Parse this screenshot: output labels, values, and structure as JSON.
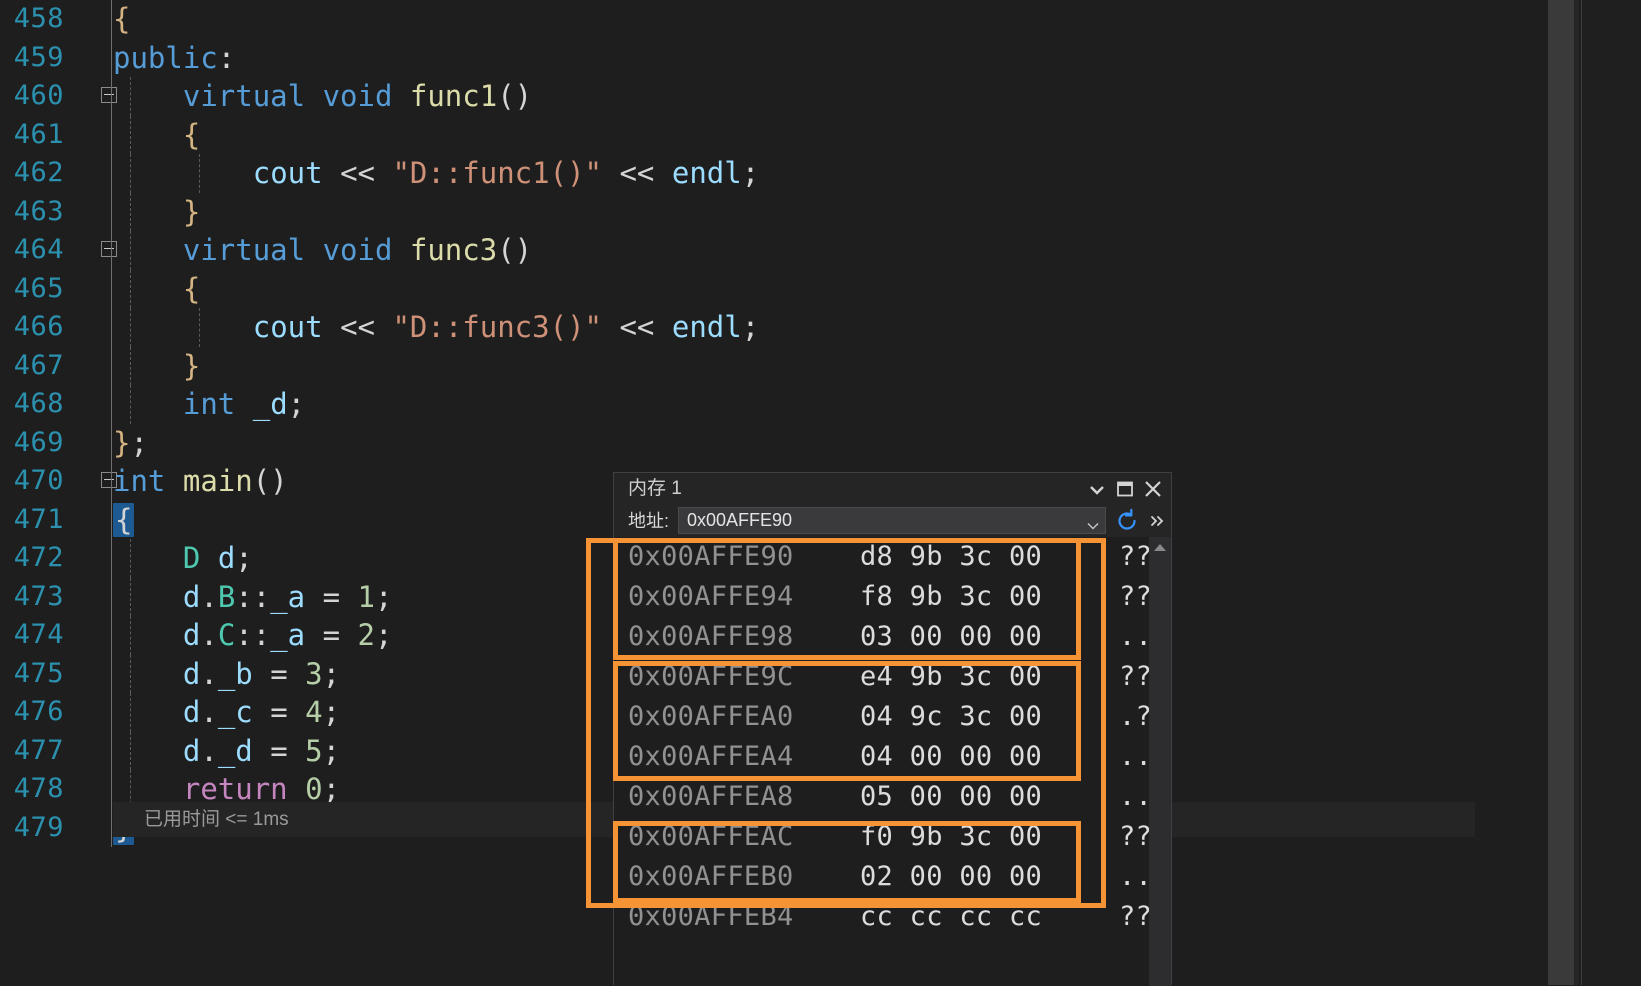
{
  "editor": {
    "lines": [
      {
        "num": "458",
        "fold": false,
        "guides": [],
        "html_id": "l458"
      },
      {
        "num": "459",
        "fold": false,
        "guides": []
      },
      {
        "num": "460",
        "fold": true,
        "guides": [
          "g1"
        ]
      },
      {
        "num": "461",
        "fold": false,
        "guides": [
          "g1"
        ]
      },
      {
        "num": "462",
        "fold": false,
        "guides": [
          "g1",
          "g2"
        ]
      },
      {
        "num": "463",
        "fold": false,
        "guides": [
          "g1"
        ]
      },
      {
        "num": "464",
        "fold": true,
        "guides": [
          "g1"
        ]
      },
      {
        "num": "465",
        "fold": false,
        "guides": [
          "g1"
        ]
      },
      {
        "num": "466",
        "fold": false,
        "guides": [
          "g1",
          "g2"
        ]
      },
      {
        "num": "467",
        "fold": false,
        "guides": [
          "g1"
        ]
      },
      {
        "num": "468",
        "fold": false,
        "guides": [
          "g1"
        ]
      },
      {
        "num": "469",
        "fold": false,
        "guides": []
      },
      {
        "num": "470",
        "fold": true,
        "guides": []
      },
      {
        "num": "471",
        "fold": false,
        "guides": []
      },
      {
        "num": "472",
        "fold": false,
        "guides": [
          "g1"
        ]
      },
      {
        "num": "473",
        "fold": false,
        "guides": [
          "g1"
        ]
      },
      {
        "num": "474",
        "fold": false,
        "guides": [
          "g1"
        ]
      },
      {
        "num": "475",
        "fold": false,
        "guides": [
          "g1"
        ]
      },
      {
        "num": "476",
        "fold": false,
        "guides": [
          "g1"
        ]
      },
      {
        "num": "477",
        "fold": false,
        "guides": [
          "g1"
        ]
      },
      {
        "num": "478",
        "fold": false,
        "guides": [
          "g1"
        ]
      },
      {
        "num": "479",
        "fold": false,
        "guides": []
      }
    ],
    "line_numbers": [
      "458",
      "459",
      "460",
      "461",
      "462",
      "463",
      "464",
      "465",
      "466",
      "467",
      "468",
      "469",
      "470",
      "471",
      "472",
      "473",
      "474",
      "475",
      "476",
      "477",
      "478",
      "479"
    ],
    "code_text": [
      "{",
      "public:",
      "    virtual void func1()",
      "    {",
      "        cout << \"D::func1()\" << endl;",
      "    }",
      "    virtual void func3()",
      "    {",
      "        cout << \"D::func3()\" << endl;",
      "    }",
      "    int _d;",
      "};",
      "int main()",
      "{",
      "    D d;",
      "    d.B::_a = 1;",
      "    d.C::_a = 2;",
      "    d._b = 3;",
      "    d._c = 4;",
      "    d._d = 5;",
      "    return 0;",
      "}"
    ],
    "elapsed_time": "已用时间 <= 1ms",
    "colors": {
      "background": "#1e1e1e",
      "line_number": "#2b91af",
      "keyword": "#569cd6",
      "type": "#4ec9b0",
      "function": "#dcdcaa",
      "string": "#ce9178",
      "variable": "#9cdcfe",
      "number": "#b5cea8",
      "control": "#c586c0",
      "brace_highlight": "#1d5a91"
    }
  },
  "memory_window": {
    "title": "内存 1",
    "address_label": "地址:",
    "address_value": "0x00AFFE90",
    "titlebar_icons": {
      "dropdown": "chevron-down-icon",
      "maximize": "maximize-icon",
      "close": "close-icon"
    },
    "toolbar_icons": {
      "refresh": "refresh-icon",
      "overflow": "double-chevron-right-icon"
    },
    "columns": [
      "address",
      "bytes",
      "ascii"
    ],
    "rows": [
      {
        "address": "0x00AFFE90",
        "bytes": "d8 9b 3c 00",
        "ascii": "??"
      },
      {
        "address": "0x00AFFE94",
        "bytes": "f8 9b 3c 00",
        "ascii": "??"
      },
      {
        "address": "0x00AFFE98",
        "bytes": "03 00 00 00",
        "ascii": ".."
      },
      {
        "address": "0x00AFFE9C",
        "bytes": "e4 9b 3c 00",
        "ascii": "??"
      },
      {
        "address": "0x00AFFEA0",
        "bytes": "04 9c 3c 00",
        "ascii": ".?"
      },
      {
        "address": "0x00AFFEA4",
        "bytes": "04 00 00 00",
        "ascii": ".."
      },
      {
        "address": "0x00AFFEA8",
        "bytes": "05 00 00 00",
        "ascii": ".."
      },
      {
        "address": "0x00AFFEAC",
        "bytes": "f0 9b 3c 00",
        "ascii": "??"
      },
      {
        "address": "0x00AFFEB0",
        "bytes": "02 00 00 00",
        "ascii": ".."
      },
      {
        "address": "0x00AFFEB4",
        "bytes": "cc cc cc cc",
        "ascii": "??"
      }
    ]
  },
  "annotations": {
    "highlight_color": "#f59335",
    "boxes": [
      {
        "name": "outer-group",
        "rows": [
          "0x00AFFE90",
          "0x00AFFEB0"
        ]
      },
      {
        "name": "group-1",
        "rows": [
          "0x00AFFE90",
          "0x00AFFE94",
          "0x00AFFE98"
        ]
      },
      {
        "name": "group-2",
        "rows": [
          "0x00AFFE9C",
          "0x00AFFEA0",
          "0x00AFFEA4"
        ]
      },
      {
        "name": "group-3",
        "rows": [
          "0x00AFFEAC",
          "0x00AFFEB0"
        ]
      }
    ]
  }
}
